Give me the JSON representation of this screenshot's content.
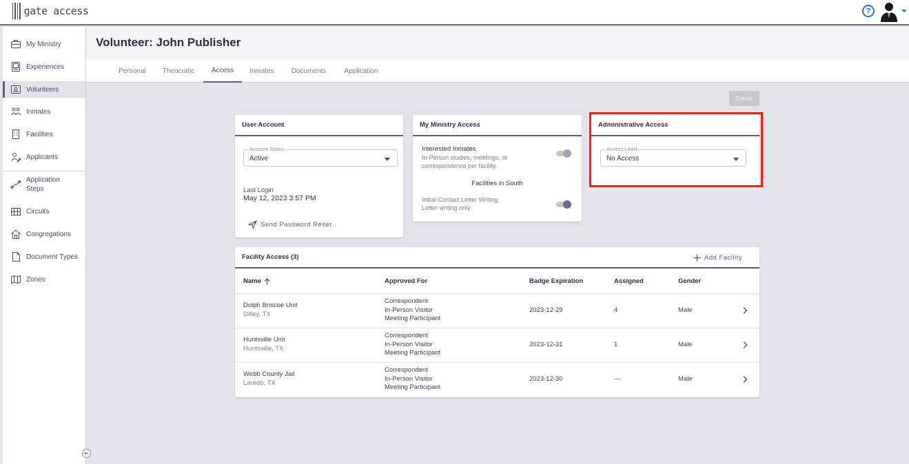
{
  "app": {
    "logo_text": "gate access"
  },
  "sidebar": {
    "items": [
      {
        "label": "My Ministry",
        "icon": "briefcase-icon"
      },
      {
        "label": "Experiences",
        "icon": "album-icon"
      },
      {
        "label": "Volunteers",
        "icon": "badge-icon",
        "active": true
      },
      {
        "label": "Inmates",
        "icon": "people-icon"
      },
      {
        "label": "Facilities",
        "icon": "building-icon"
      },
      {
        "label": "Applicants",
        "icon": "user-edit-icon"
      },
      {
        "label": "Application Steps",
        "icon": "steps-icon"
      },
      {
        "label": "Circuits",
        "icon": "grid-building-icon"
      },
      {
        "label": "Congregations",
        "icon": "house-icon"
      },
      {
        "label": "Document Types",
        "icon": "document-icon"
      },
      {
        "label": "Zones",
        "icon": "map-icon"
      }
    ],
    "collapse_icon": "collapse-left-icon"
  },
  "page": {
    "title": "Volunteer: John Publisher"
  },
  "tabs": [
    {
      "label": "Personal"
    },
    {
      "label": "Theocratic"
    },
    {
      "label": "Access",
      "active": true
    },
    {
      "label": "Inmates"
    },
    {
      "label": "Documents"
    },
    {
      "label": "Application"
    }
  ],
  "save_label": "Save",
  "user_account": {
    "title": "User Account",
    "status_legend": "Account Status",
    "status_value": "Active",
    "last_login_label": "Last Login",
    "last_login_value": "May 12, 2023 3:57 PM",
    "reset_label": "Send Password Reset"
  },
  "ministry_access": {
    "title": "My Ministry Access",
    "item1_title": "Interested Inmates",
    "item1_desc1": "In-Person studies, meetings, or",
    "item1_desc2": "correspondence per facility.",
    "facilities_note": "Facilities in South",
    "item2_title": "Initial Contact Letter Writing",
    "item2_desc": "Letter writing only",
    "item1_enabled": true,
    "item2_enabled": true
  },
  "admin_access": {
    "title": "Administrative Access",
    "level_legend": "Access Level",
    "level_value": "No Access"
  },
  "facility_access": {
    "title": "Facility Access (3)",
    "add_label": "Add Facility",
    "columns": [
      "Name",
      "Approved For",
      "Badge Expiration",
      "Assigned",
      "Gender"
    ],
    "rows": [
      {
        "name": "Dolph Briscoe Unit",
        "location": "Dilley, TX",
        "approved": [
          "Correspondent",
          "In-Person Visitor",
          "Meeting Participant"
        ],
        "badge": "2023-12-29",
        "assigned": "4",
        "gender": "Male"
      },
      {
        "name": "Huntsville Unit",
        "location": "Huntsville, TX",
        "approved": [
          "Correspondent",
          "In-Person Visitor",
          "Meeting Participant"
        ],
        "badge": "2023-12-31",
        "assigned": "1",
        "gender": "Male"
      },
      {
        "name": "Webb County Jail",
        "location": "Laredo, TX",
        "approved": [
          "Correspondent",
          "In-Person Visitor",
          "Meeting Participant"
        ],
        "badge": "2023-12-30",
        "assigned": "—",
        "gender": "Male"
      }
    ]
  },
  "colors": {
    "accent": "#5e5a85",
    "highlight": "#e0271b",
    "help": "#2a6fdb"
  }
}
